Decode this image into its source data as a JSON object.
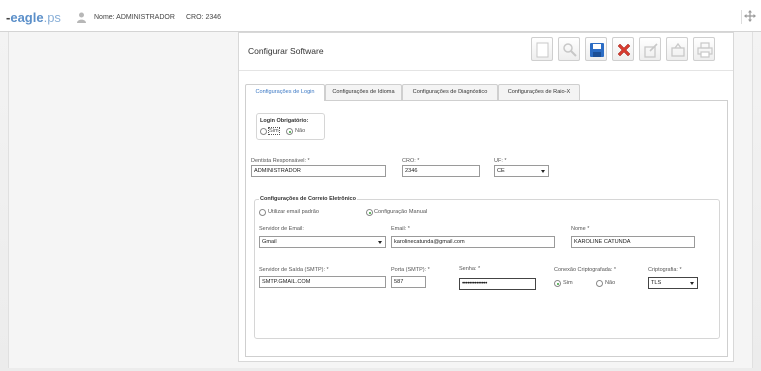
{
  "topbar": {
    "logo_dash": "-",
    "logo_brand": "eagle",
    "logo_ps": ".ps",
    "user_name": "Nome: ADMINISTRADOR",
    "user_cro": "CRO: 2346"
  },
  "header": {
    "title": "Configurar Software"
  },
  "toolbar": [
    "new-icon",
    "search-icon",
    "save-icon",
    "delete-icon",
    "edit-icon",
    "export-icon",
    "print-icon"
  ],
  "tabs": [
    {
      "label": "Configurações de Login",
      "active": true
    },
    {
      "label": "Configurações de Idioma",
      "active": false
    },
    {
      "label": "Configurações de Diagnóstico",
      "active": false
    },
    {
      "label": "Configurações de Raio-X",
      "active": false
    }
  ],
  "login": {
    "legend": "Login Obrigatório:",
    "options": [
      "Sim",
      "Não"
    ],
    "selected": "Não"
  },
  "dentist": {
    "label": "Dentista Responsável: *",
    "value": "ADMINISTRADOR",
    "cro_label": "CRO: *",
    "cro_value": "2346",
    "uf_label": "UF: *",
    "uf_value": "CE"
  },
  "email": {
    "legend": "Configurações de Correio Eletrônico",
    "option_default": "Utilizar email padrão",
    "option_manual": "Configuração Manual",
    "selected": "Configuração Manual",
    "server_label": "Servidor de Email:",
    "server_value": "Gmail",
    "email_label": "Email: *",
    "email_value": "karolinecatunda@gmail.com",
    "name_label": "Nome *",
    "name_value": "KAROLINE CATUNDA",
    "smtp_label": "Servidor de Saída (SMTP): *",
    "smtp_value": "SMTP.GMAIL.COM",
    "port_label": "Porta (SMTP): *",
    "port_value": "587",
    "password_label": "Senha: *",
    "password_value": "••••••••••••••",
    "crypto_conn_label": "Conexão Criptografada: *",
    "crypto_conn_options": [
      "Sim",
      "Não"
    ],
    "crypto_conn_selected": "Sim",
    "crypto_label": "Criptografia: *",
    "crypto_value": "TLS"
  },
  "colors": {
    "brand": "#5b8fc9",
    "active_tab": "#3b78c4",
    "radio_on": "#3aa33a",
    "delete_red": "#d63b2f",
    "save_blue": "#2b6cc4"
  }
}
